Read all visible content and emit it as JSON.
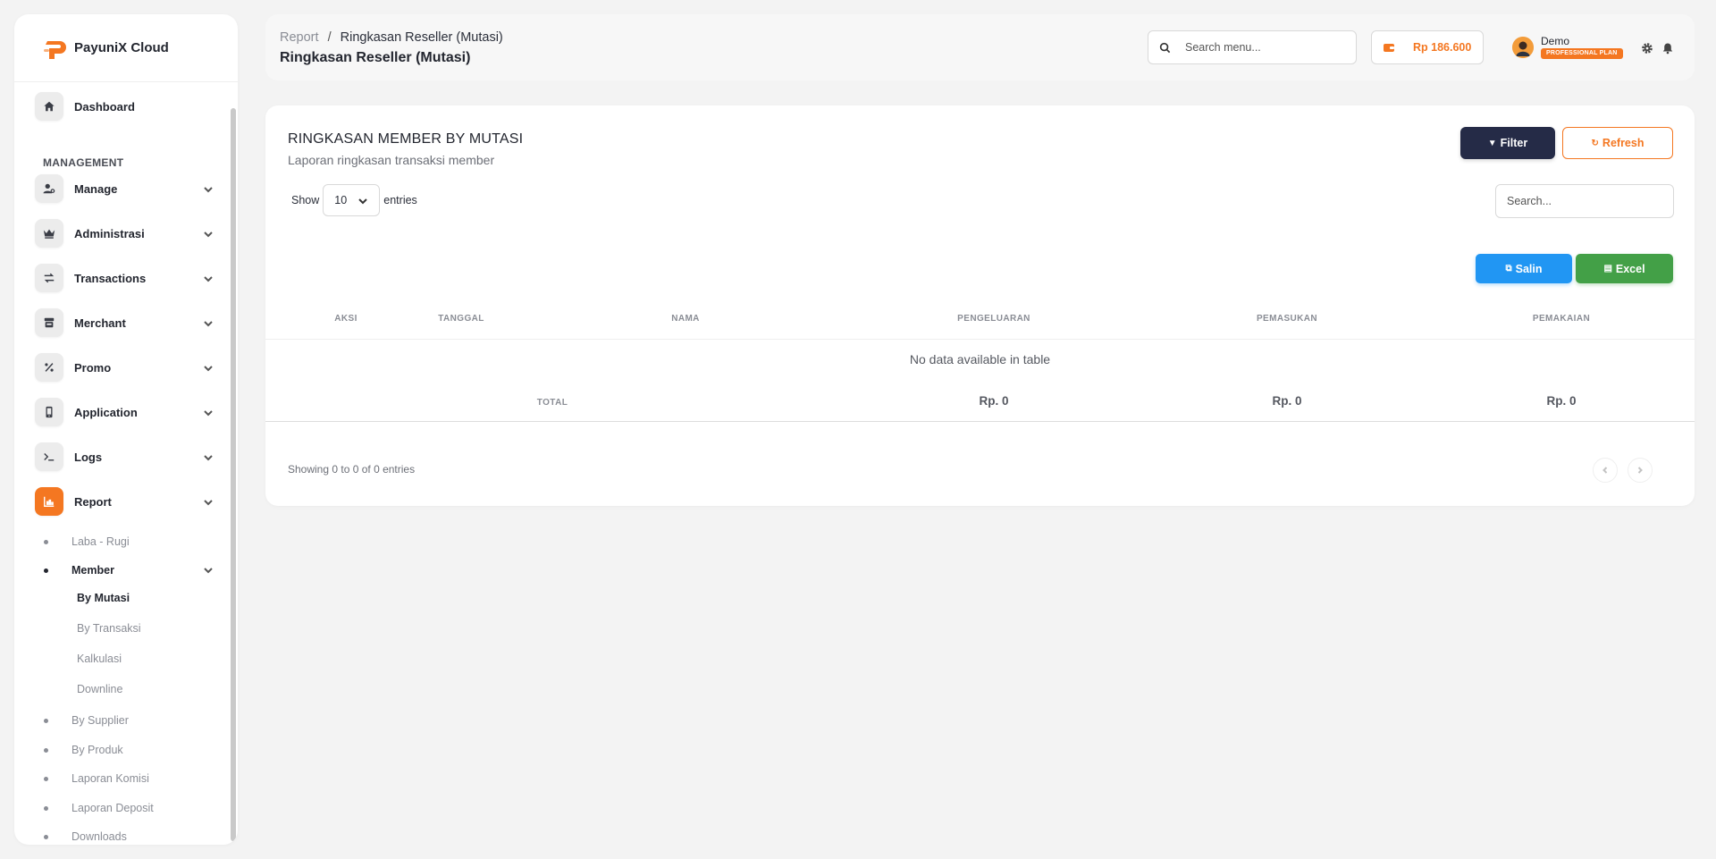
{
  "brand": {
    "name": "PayuniX Cloud"
  },
  "sidebar": {
    "dashboard": "Dashboard",
    "section": "MANAGEMENT",
    "menu": [
      {
        "label": "Manage",
        "icon": "user-gear-icon"
      },
      {
        "label": "Administrasi",
        "icon": "crown-icon"
      },
      {
        "label": "Transactions",
        "icon": "arrows-swap-icon"
      },
      {
        "label": "Merchant",
        "icon": "store-icon"
      },
      {
        "label": "Promo",
        "icon": "percent-icon"
      },
      {
        "label": "Application",
        "icon": "mobile-icon"
      },
      {
        "label": "Logs",
        "icon": "terminal-icon"
      },
      {
        "label": "Report",
        "icon": "chart-icon"
      }
    ],
    "report_sub": [
      "Laba - Rugi",
      "Member",
      "By Supplier",
      "By Produk",
      "Laporan Komisi",
      "Laporan Deposit",
      "Downloads"
    ],
    "member_sub": [
      "By Mutasi",
      "By Transaksi",
      "Kalkulasi",
      "Downline"
    ]
  },
  "header": {
    "breadcrumb_root": "Report",
    "breadcrumb_sep": "/",
    "breadcrumb_current": "Ringkasan Reseller (Mutasi)",
    "title": "Ringkasan Reseller (Mutasi)",
    "search_placeholder": "Search menu...",
    "balance": "Rp 186.600",
    "user_name": "Demo",
    "plan": "PROFESSIONAL PLAN"
  },
  "card": {
    "title": "RINGKASAN MEMBER BY MUTASI",
    "subtitle": "Laporan ringkasan transaksi member",
    "filter_label": "Filter",
    "refresh_label": "Refresh",
    "show_label": "Show",
    "entries_value": "10",
    "entries_label": "entries",
    "search_placeholder": "Search...",
    "copy_label": "Salin",
    "excel_label": "Excel",
    "columns": [
      "AKSI",
      "TANGGAL",
      "NAMA",
      "PENGELUARAN",
      "PEMASUKAN",
      "PEMAKAIAN"
    ],
    "empty_message": "No data available in table",
    "total_label": "TOTAL",
    "totals": [
      "Rp. 0",
      "Rp. 0",
      "Rp. 0"
    ],
    "info": "Showing 0 to 0 of 0 entries"
  },
  "colors": {
    "accent": "#f47721",
    "filter_button": "#252b47",
    "copy_button": "#2196f3",
    "excel_button": "#43a047"
  }
}
